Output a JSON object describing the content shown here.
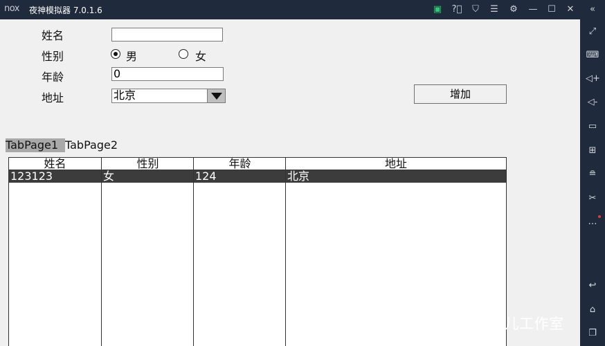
{
  "window": {
    "logo_text": "nox",
    "title": "夜神模拟器 7.0.1.6",
    "controls": [
      "store-icon",
      "help-icon",
      "shirt-icon",
      "menu-icon",
      "settings-icon",
      "minimize-icon",
      "maximize-icon",
      "close-icon",
      "collapse-sidebar-icon"
    ]
  },
  "sidebar": {
    "icons": [
      "fullscreen-icon",
      "keyboard-icon",
      "volume-up-icon",
      "volume-down-icon",
      "screen-icon",
      "add-apk-icon",
      "multi-instance-icon",
      "scissors-icon",
      "more-icon",
      "back-icon",
      "home-icon",
      "recent-apps-icon"
    ]
  },
  "form": {
    "name_label": "姓名",
    "name_value": "",
    "gender_label": "性别",
    "gender_male": "男",
    "gender_female": "女",
    "gender_selected": "男",
    "age_label": "年龄",
    "age_value": "0",
    "address_label": "地址",
    "address_value": "北京",
    "add_button": "增加"
  },
  "tabs": [
    "TabPage1",
    "TabPage2"
  ],
  "active_tab": "TabPage1",
  "table": {
    "columns": [
      "姓名",
      "性别",
      "年龄",
      "地址"
    ],
    "rows": [
      [
        "123123",
        "女",
        "124",
        "北京"
      ]
    ]
  },
  "watermark": "知乎 @红孩儿工作室"
}
